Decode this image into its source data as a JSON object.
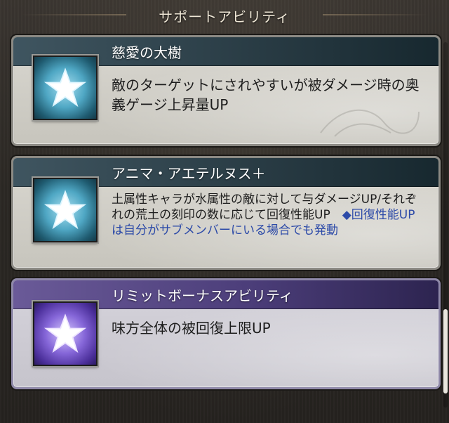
{
  "header": {
    "title": "サポートアビリティ"
  },
  "abilities": [
    {
      "name": "慈愛の大樹",
      "description": "敵のターゲットにされやすいが被ダメージ時の奥義ゲージ上昇量UP",
      "icon": "star-icon",
      "theme": "blue"
    },
    {
      "name": "アニマ・アエテルヌス＋",
      "description": "土属性キャラが水属性の敵に対して与ダメージUP/それぞれの荒土の刻印の数に応じて回復性能UP",
      "note": "◆回復性能UPは自分がサブメンバーにいる場合でも発動",
      "icon": "star-icon",
      "theme": "blue"
    },
    {
      "name": "リミットボーナスアビリティ",
      "description": "味方全体の被回復上限UP",
      "icon": "star-icon",
      "theme": "purple"
    }
  ],
  "colors": {
    "title_bar_blue": "#2c3f48",
    "title_bar_purple": "#4c3e7a",
    "note_text": "#2c4aa8"
  }
}
